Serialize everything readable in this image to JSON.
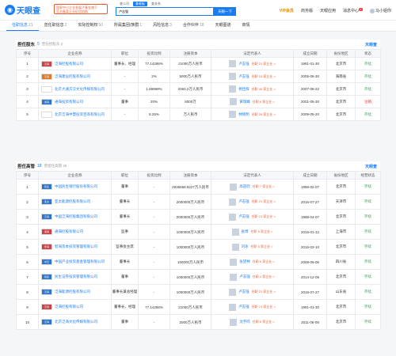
{
  "header": {
    "logo_text": "天眼查",
    "badge_line1": "国家中小企业发展子基金旗下",
    "badge_line2": "官方备案企业征信机构",
    "search_tabs": [
      "查公司",
      "查老板",
      "查关系"
    ],
    "search_value": "卢志强",
    "search_button": "天眼一下",
    "nav": {
      "vip": "VIP会员",
      "product": "商务版",
      "app": "天眼应用",
      "notify": "消息中心",
      "notify_count": "8",
      "user": "马小姐你"
    },
    "colors": {
      "brand": "#1b7cf2",
      "accent": "#e65a2e"
    }
  },
  "tabs": [
    {
      "label": "任职信息",
      "count": "21"
    },
    {
      "label": "曾任职信息",
      "count": "2"
    },
    {
      "label": "实际控制权",
      "count": "50"
    },
    {
      "label": "所属集团/族群",
      "count": "1"
    },
    {
      "label": "风险信息",
      "count": "3"
    },
    {
      "label": "合作伙伴",
      "count": "18"
    },
    {
      "label": "天眼图谱",
      "count": ""
    },
    {
      "label": "商情",
      "count": ""
    }
  ],
  "sections": [
    {
      "title": "担任股东",
      "count": "5",
      "history": "曾任控股东",
      "history_count": "2",
      "brand": "天眼查",
      "columns": [
        "序号",
        "企业名称",
        "职位",
        "投资比例",
        "注册资本",
        "法定代表人",
        "成立日期",
        "省份地区",
        "状态"
      ],
      "rows": [
        {
          "no": "1",
          "logo_color": "#c9444a",
          "logo_text": "泛海",
          "name": "泛海控股有限公司",
          "position": "董事长、经理",
          "ratio": "77.14286%",
          "capital": "21000万人民币",
          "legal": "卢志强",
          "tag": "任职 21 家企业 >",
          "date": "1991-01-30",
          "region": "北京市",
          "status": "存续"
        },
        {
          "no": "2",
          "logo_color": "#d97a2b",
          "logo_text": "泛海",
          "name": "泛海建设控股有限公司",
          "position": "-",
          "ratio": "2%",
          "capital": "5000万人民币",
          "legal": "卢志强",
          "tag": "任职 15 家企业 >",
          "date": "2005-06-30",
          "region": "海南省",
          "status": "存续"
        },
        {
          "no": "3",
          "logo_color": "#ffffff",
          "logo_text": "",
          "name": "北京大通方汉文化传媒有限公司",
          "position": "-",
          "ratio": "1.89999%",
          "capital": "2063.2万人民币",
          "legal": "杨佳辉",
          "tag": "任职 40 家企业 >",
          "date": "2007-08-22",
          "region": "北京市",
          "status": "存续"
        },
        {
          "no": "4",
          "logo_color": "#2f75c9",
          "logo_text": "通海",
          "name": "通海投资有限公司",
          "position": "董事",
          "ratio": "20%",
          "capital": "6000万",
          "legal": "黄瑞峰",
          "tag": "任职 6 家企业 >",
          "date": "2001-05-30",
          "region": "北京市",
          "status": "注销"
        },
        {
          "no": "5",
          "logo_color": "#ffffff",
          "logo_text": "",
          "name": "北京泛海中慧投资咨询有限公司",
          "position": "-",
          "ratio": "8.25%",
          "capital": "万人民币",
          "legal": "林晓明",
          "tag": "任职 25 家企业 >",
          "date": "2009-05-20",
          "region": "北京市",
          "status": "存续"
        }
      ]
    },
    {
      "title": "担任高管",
      "count": "18",
      "history": "曾担任高管",
      "history_count": "25",
      "brand": "天眼查",
      "columns": [
        "序号",
        "企业名称",
        "职位",
        "投资比例",
        "注册资本",
        "法定代表人",
        "成立日期",
        "省份地区",
        "经营状态"
      ],
      "rows": [
        {
          "no": "1",
          "logo_color": "#2f75c9",
          "logo_text": "民生",
          "name": "中国民生银行股份有限公司",
          "position": "董事",
          "ratio": "-",
          "capital": "2836558.5227万人民币",
          "legal": "高迎欣",
          "tag": "任职 7 家企业 >",
          "date": "1996-02-07",
          "region": "北京市",
          "status": "存续"
        },
        {
          "no": "2",
          "logo_color": "#2f75c9",
          "logo_text": "亚太",
          "name": "亚太能源控股有限公司",
          "position": "董事长",
          "ratio": "-",
          "capital": "2000000万人民币",
          "legal": "卢志强",
          "tag": "任职 21 家企业 >",
          "date": "2016-07-27",
          "region": "天津市",
          "status": "存续"
        },
        {
          "no": "3",
          "logo_color": "#2f75c9",
          "logo_text": "泛海",
          "name": "中国泛海控股集团有限公司",
          "position": "董事长",
          "ratio": "-",
          "capital": "2000000万人民币",
          "legal": "卢志强",
          "tag": "任职 21 家企业 >",
          "date": "1988-04-07",
          "region": "北京市",
          "status": "存续"
        },
        {
          "no": "4",
          "logo_color": "#c9444a",
          "logo_text": "通海",
          "name": "通海控股有限公司",
          "position": "监事",
          "ratio": "-",
          "capital": "1000000万人民币",
          "legal": "张博",
          "tag": "任职 5 家企业 >",
          "date": "2016-01-12",
          "region": "上海市",
          "status": "存续"
        },
        {
          "no": "5",
          "logo_color": "#c9444a",
          "logo_text": "智海",
          "name": "智海资本投资管理有限公司",
          "position": "监事会主席",
          "ratio": "-",
          "capital": "1000000万人民币",
          "legal": "刘冰",
          "tag": "任职 3 家企业 >",
          "date": "2016-03-10",
          "region": "北京市",
          "status": "存续"
        },
        {
          "no": "6",
          "logo_color": "#2f75c9",
          "logo_text": "中泛",
          "name": "中国产业投资基金管理有限公司",
          "position": "董事长",
          "ratio": "-",
          "capital": "100000万人民币",
          "legal": "张望林",
          "tag": "任职 6 家企业 >",
          "date": "2008-06-06",
          "region": "四川省",
          "status": "存续"
        },
        {
          "no": "7",
          "logo_color": "#2f75c9",
          "logo_text": "民投",
          "name": "民生证券投资管理有限公司",
          "position": "董事",
          "ratio": "-",
          "capital": "1000000万人民币",
          "legal": "卢志强",
          "tag": "任职 4 家企业 >",
          "date": "2014-12-05",
          "region": "北京市",
          "status": "存续"
        },
        {
          "no": "8",
          "logo_color": "#2f75c9",
          "logo_text": "泛海",
          "name": "泛海能源控股有限公司",
          "position": "董事长兼总经理",
          "ratio": "-",
          "capital": "1000000万人民币",
          "legal": "卢志强",
          "tag": "任职 21 家企业 >",
          "date": "2016-07-27",
          "region": "山东省",
          "status": "存续"
        },
        {
          "no": "9",
          "logo_color": "#c9444a",
          "logo_text": "泛海",
          "name": "泛海控股有限公司",
          "position": "董事长、经理",
          "ratio": "77.14286%",
          "capital": "21000万人民币",
          "legal": "卢志强",
          "tag": "任职 21 家企业 >",
          "date": "1991-01-30",
          "region": "北京市",
          "status": "存续"
        },
        {
          "no": "10",
          "logo_color": "#2f75c9",
          "logo_text": "泛海",
          "name": "北京泛海文化传媒有限公司",
          "position": "董事",
          "ratio": "-",
          "capital": "2000万人民币",
          "legal": "沈宇鸣",
          "tag": "任职 6 家企业 >",
          "date": "2011-06-08",
          "region": "北京市",
          "status": "存续"
        }
      ]
    }
  ]
}
